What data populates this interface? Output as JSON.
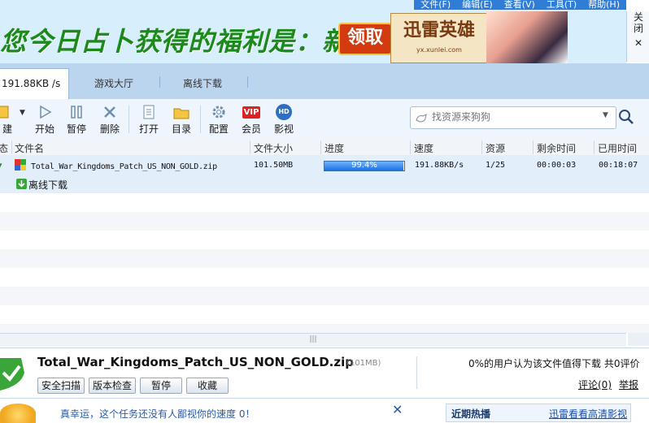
{
  "window": {
    "menu": [
      "文件(F)",
      "编辑(E)",
      "查看(V)",
      "工具(T)",
      "帮助(H)"
    ]
  },
  "banner": {
    "slogan": "您今日占卜获得的福利是：新手卡",
    "claim_label": "领取",
    "logo_title": "迅雷英雄",
    "logo_url": "yx.xunlei.com",
    "side_close": [
      "关",
      "闭",
      "✕"
    ]
  },
  "tabs": {
    "speed": "191.88KB /s",
    "game_hall": "游戏大厅",
    "offline": "离线下载"
  },
  "toolbar": {
    "new": "建",
    "start": "开始",
    "pause": "暂停",
    "delete": "删除",
    "open": "打开",
    "folder": "目录",
    "config": "配置",
    "vip": "会员",
    "video": "影视",
    "vip_badge": "VIP",
    "hd_badge": "HD"
  },
  "search": {
    "placeholder": "找资源来狗狗"
  },
  "table": {
    "headers": {
      "status": "态",
      "name": "文件名",
      "size": "文件大小",
      "progress": "进度",
      "speed": "速度",
      "resource": "资源",
      "remaining": "剩余时间",
      "elapsed": "已用时间"
    },
    "rows": [
      {
        "name": "Total_War_Kingdoms_Patch_US_NON_GOLD.zip",
        "size": "101.50MB",
        "progress_text": "99.4%",
        "progress_fraction": 0.994,
        "speed": "191.88KB/s",
        "resource": "1/25",
        "remaining": "00:00:03",
        "elapsed": "00:18:07",
        "sub_label": "离线下载"
      }
    ]
  },
  "detail": {
    "file_name": "Total_War_Kingdoms_Patch_US_NON_GOLD.zip",
    "file_size": "(101MB)",
    "buttons": {
      "scan": "安全扫描",
      "version": "版本检查",
      "pause": "暂停",
      "favorite": "收藏"
    },
    "rating_text": "0%的用户认为该文件值得下载 共0评价",
    "comment_link": "评论(0)",
    "report_link": "举报"
  },
  "bottom": {
    "lucky_text": "真幸运，这个任务还没有人鄙视你的速度 0！",
    "close": "✕",
    "hot_title": "近期热播",
    "hot_link": "迅雷看看高清影视"
  },
  "hscroll_grip": "|||",
  "colors": {
    "accent": "#2f7dd6",
    "progress": "#1f6fe0",
    "slogan": "#1b8a1b",
    "claim": "#d23a10"
  }
}
